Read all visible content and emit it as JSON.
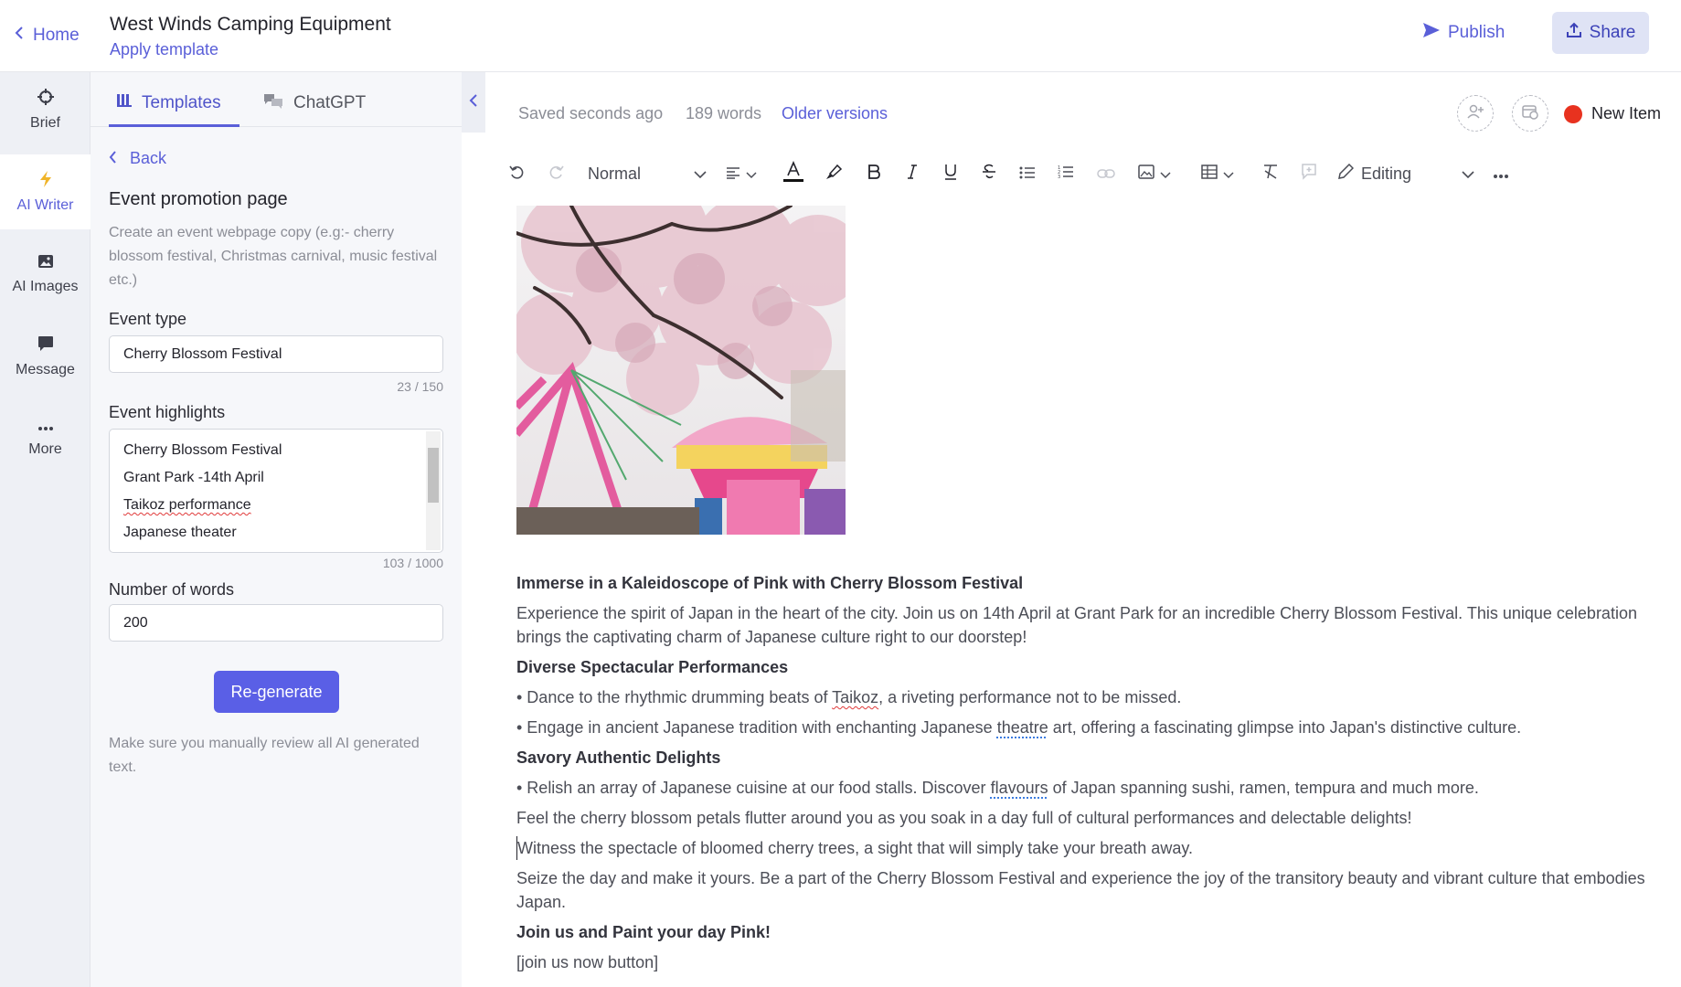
{
  "header": {
    "home_label": "Home",
    "doc_title": "West Winds Camping Equipment",
    "apply_template": "Apply template",
    "publish_label": "Publish",
    "share_label": "Share"
  },
  "rail": {
    "items": [
      {
        "label": "Brief",
        "icon": "crosshair-icon"
      },
      {
        "label": "AI Writer",
        "icon": "lightning-icon"
      },
      {
        "label": "AI Images",
        "icon": "image-icon"
      },
      {
        "label": "Message",
        "icon": "chat-icon"
      },
      {
        "label": "More",
        "icon": "more-icon"
      }
    ]
  },
  "panel": {
    "tabs": [
      {
        "label": "Templates",
        "icon": "templates-icon"
      },
      {
        "label": "ChatGPT",
        "icon": "chat-bubbles-icon"
      }
    ],
    "back_label": "Back",
    "title": "Event promotion page",
    "description": "Create an event webpage copy (e.g:- cherry blossom festival, Christmas carnival, music festival etc.)",
    "event_type": {
      "label": "Event type",
      "value": "Cherry Blossom Festival",
      "counter": "23 / 150"
    },
    "event_highlights": {
      "label": "Event highlights",
      "lines": [
        "Cherry Blossom Festival",
        "Grant Park -14th April",
        "Taikoz performance",
        "Japanese theater"
      ],
      "counter": "103 / 1000"
    },
    "num_words": {
      "label": "Number of words",
      "value": "200"
    },
    "regenerate_label": "Re-generate",
    "review_note": "Make sure you manually review all AI generated text."
  },
  "editor": {
    "saved_status": "Saved seconds ago",
    "word_count": "189 words",
    "older_versions": "Older versions",
    "new_item_label": "New Item",
    "toolbar": {
      "style_select": "Normal",
      "mode_select": "Editing"
    },
    "content": {
      "heading1": "Immerse in a Kaleidoscope of Pink with Cherry Blossom Festival",
      "para1": "Experience the spirit of Japan in the heart of the city. Join us on 14th April at Grant Park for an incredible Cherry Blossom Festival. This unique celebration brings the captivating charm of Japanese culture right to our doorstep!",
      "heading2": "Diverse Spectacular Performances",
      "bullet1_pre": "• Dance to the rhythmic drumming beats of ",
      "bullet1_word": "Taikoz",
      "bullet1_post": ", a riveting performance not to be missed.",
      "bullet2_pre": "• Engage in ancient Japanese tradition with enchanting Japanese ",
      "bullet2_word": "theatre",
      "bullet2_post": " art, offering a fascinating glimpse into Japan's distinctive culture.",
      "heading3": "Savory Authentic Delights",
      "bullet3_pre": "• Relish an array of Japanese cuisine at our food stalls. Discover ",
      "bullet3_word": "flavours",
      "bullet3_post": " of Japan spanning sushi, ramen, tempura and much more.",
      "para2": "Feel the cherry blossom petals flutter around you as you soak in a day full of cultural performances and delectable delights!",
      "para3": "Witness the spectacle of bloomed cherry trees, a sight that will simply take your breath away.",
      "para4": "Seize the day and make it yours. Be a part of the Cherry Blossom Festival and experience the joy of the transitory beauty and vibrant culture that embodies Japan.",
      "heading4": "Join us and Paint your day Pink!",
      "para5": "[join us now button]"
    }
  },
  "colors": {
    "accent": "#5a5fd8",
    "button_primary": "#5a5fe6",
    "share_bg": "#dfe3f5",
    "status_red": "#e8321f"
  }
}
